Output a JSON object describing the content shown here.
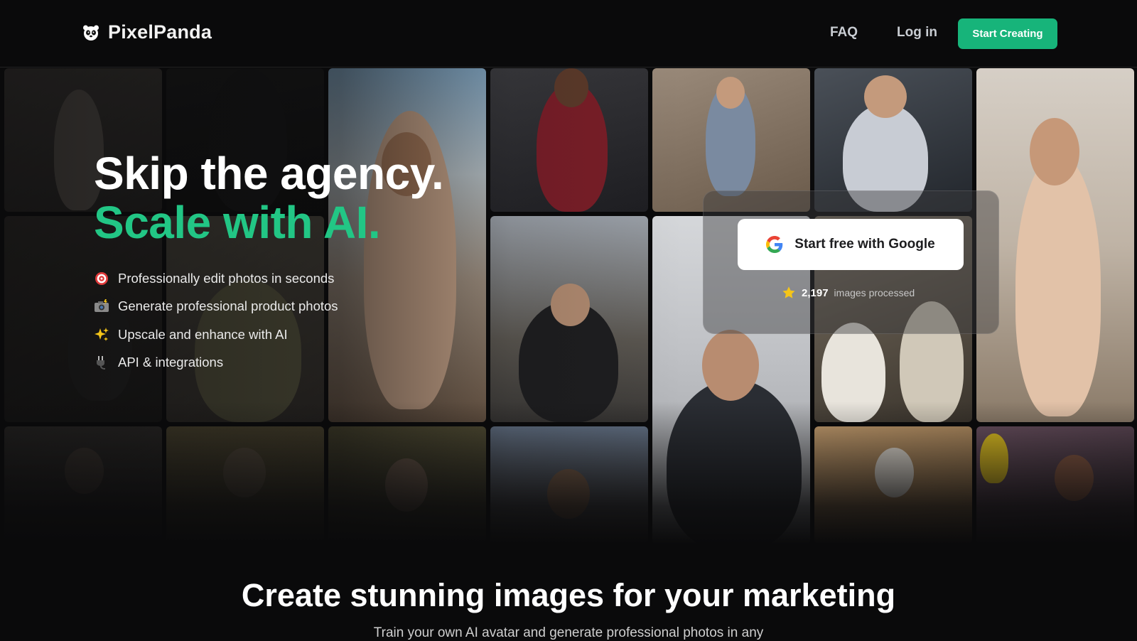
{
  "nav": {
    "brand": "PixelPanda",
    "faq": "FAQ",
    "login": "Log in",
    "cta": "Start Creating"
  },
  "hero": {
    "headline_line1": "Skip the agency.",
    "headline_line2": "Scale with AI.",
    "features": [
      {
        "icon": "target-icon",
        "text": "Professionally edit photos in seconds"
      },
      {
        "icon": "camera-flash-icon",
        "text": "Generate professional product photos"
      },
      {
        "icon": "sparkles-icon",
        "text": "Upscale and enhance with AI"
      },
      {
        "icon": "plug-icon",
        "text": "API & integrations"
      }
    ],
    "google_button": "Start free with Google",
    "stats_count": "2,197",
    "stats_label": "images processed"
  },
  "section": {
    "title": "Create stunning images for your marketing",
    "subtitle": "Train your own AI avatar and generate professional photos in any"
  },
  "colors": {
    "accent": "#22c685",
    "cta_bg": "#17b47a",
    "background": "#0a0a0b"
  }
}
